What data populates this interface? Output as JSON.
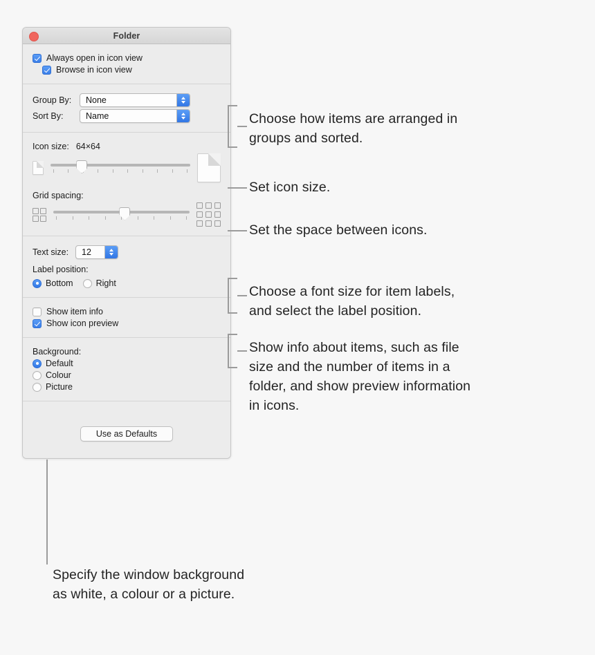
{
  "window": {
    "title": "Folder",
    "close_button": "close",
    "view_options": {
      "always_open_label": "Always open in icon view",
      "always_open_checked": true,
      "browse_label": "Browse in icon view",
      "browse_checked": true,
      "group_by_label": "Group By:",
      "group_by_value": "None",
      "sort_by_label": "Sort By:",
      "sort_by_value": "Name",
      "icon_size_label": "Icon size:",
      "icon_size_value": "64×64",
      "icon_size_slider_percent": 22,
      "icon_size_tick_count": 10,
      "grid_spacing_label": "Grid spacing:",
      "grid_spacing_slider_percent": 52,
      "grid_spacing_tick_count": 9,
      "text_size_label": "Text size:",
      "text_size_value": "12",
      "label_position_label": "Label position:",
      "label_position_bottom": "Bottom",
      "label_position_right": "Right",
      "label_position_selected": "Bottom",
      "show_item_info_label": "Show item info",
      "show_item_info_checked": false,
      "show_icon_preview_label": "Show icon preview",
      "show_icon_preview_checked": true,
      "background_label": "Background:",
      "background_default": "Default",
      "background_colour": "Colour",
      "background_picture": "Picture",
      "background_selected": "Default",
      "use_as_defaults_label": "Use as Defaults"
    }
  },
  "callouts": [
    {
      "id": "group-sort",
      "line1": "Choose how items are arranged in",
      "line2": "groups and sorted."
    },
    {
      "id": "icon-size",
      "line1": "Set icon size.",
      "line2": ""
    },
    {
      "id": "grid-spacing",
      "line1": "Set the space between icons.",
      "line2": ""
    },
    {
      "id": "text-label",
      "line1": "Choose a font size for item labels,",
      "line2": "and select the label position."
    },
    {
      "id": "show-info",
      "line1": "Show info about items, such as file",
      "line2": "size and the number of items in a",
      "line3": "folder, and show preview information",
      "line4": "in icons."
    },
    {
      "id": "background",
      "line1": "Specify the window background",
      "line2": "as white, a colour or a picture."
    }
  ],
  "colors": {
    "accent_blue": "#3b7fe8",
    "close_red": "#f0665e",
    "window_bg": "#ececec",
    "page_bg": "#f7f7f7",
    "callout_line": "#9b9b9b"
  }
}
